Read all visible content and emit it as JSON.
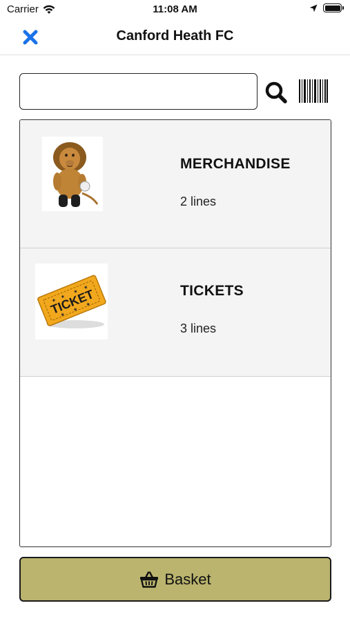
{
  "status_bar": {
    "carrier": "Carrier",
    "time": "11:08 AM"
  },
  "nav": {
    "title": "Canford Heath FC",
    "close_icon": "close-x-icon",
    "accent_color": "#1a73e8"
  },
  "search": {
    "value": "",
    "placeholder": "",
    "search_icon": "magnifier-icon",
    "barcode_icon": "barcode-icon"
  },
  "categories": [
    {
      "name": "MERCHANDISE",
      "count": "2 lines",
      "image_icon": "lion-plush-icon"
    },
    {
      "name": "TICKETS",
      "count": "3 lines",
      "image_icon": "ticket-icon"
    }
  ],
  "basket": {
    "label": "Basket",
    "icon": "basket-icon",
    "color": "#bab46e"
  }
}
